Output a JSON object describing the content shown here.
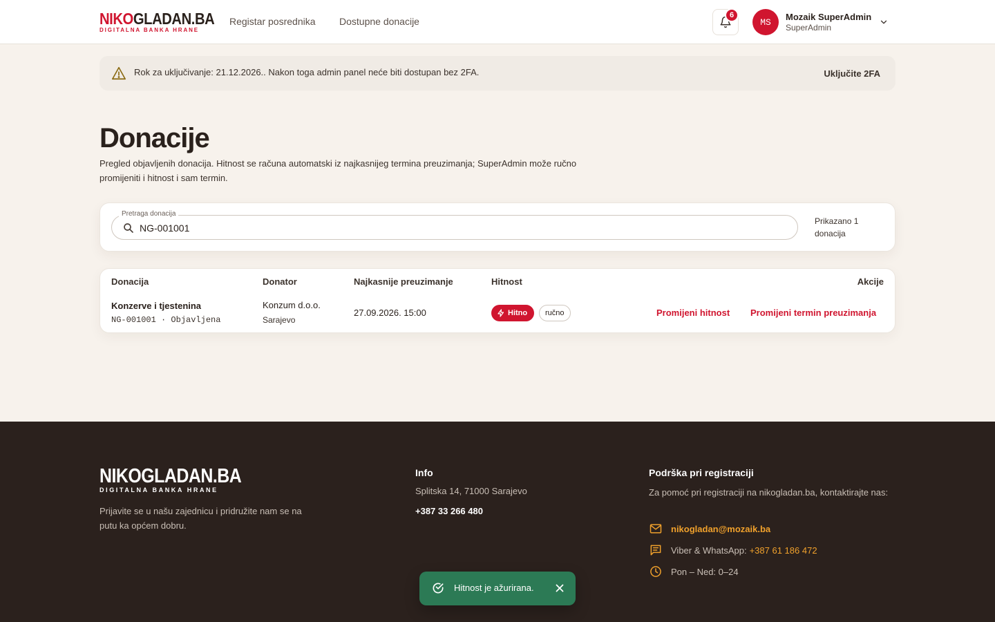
{
  "brand": {
    "wordmark_a": "NIKO",
    "wordmark_b": "GLADAN.BA",
    "tagline": "DIGITALNA BANKA HRANE"
  },
  "nav": {
    "items": [
      {
        "label": "Registar posrednika"
      },
      {
        "label": "Dostupne donacije"
      }
    ]
  },
  "notifications": {
    "count": "6",
    "icon": "bell-icon"
  },
  "user": {
    "initials": "MS",
    "name": "Mozaik SuperAdmin",
    "role": "SuperAdmin"
  },
  "banner": {
    "text": "Rok za uključivanje: 21.12.2026.. Nakon toga admin panel neće biti dostupan bez 2FA.",
    "action": "Uključite 2FA",
    "icon": "warning-icon"
  },
  "page": {
    "title": "Donacije",
    "description": "Pregled objavljenih donacija. Hitnost se računa automatski iz najkasnijeg termina preuzimanja; SuperAdmin može ručno promijeniti i hitnost i sam termin."
  },
  "search": {
    "legend": "Pretraga donacija",
    "value": "NG-001001",
    "count_text": "Prikazano 1 donacija"
  },
  "table": {
    "columns": [
      "Donacija",
      "Donator",
      "Najkasnije preuzimanje",
      "Hitnost",
      "Akcije"
    ],
    "rows": [
      {
        "title": "Konzerve i tjestenina",
        "code": "NG-001001 · Objavljena",
        "donor": "Konzum d.o.o.",
        "city": "Sarajevo",
        "deadline": "27.09.2026. 15:00",
        "urgency": "Hitno",
        "urgency_mode": "ručno",
        "action_urgency": "Promijeni hitnost",
        "action_deadline": "Promijeni termin preuzimanja"
      }
    ]
  },
  "footer": {
    "wordmark": "NIKOGLADAN.BA",
    "tagline": "DIGITALNA BANKA HRANE",
    "about": "Prijavite se u našu zajednicu i pridružite nam se na putu ka općem dobru.",
    "info_title": "Info",
    "address": "Splitska 14, 71000 Sarajevo",
    "phone": "+387 33 266 480",
    "support_title": "Podrška pri registraciji",
    "support_text": "Za pomoć pri registraciji na nikogladan.ba, kontaktirajte nas:",
    "email": "nikogladan@mozaik.ba",
    "viber_label": "Viber & WhatsApp:",
    "viber_number": "+387 61 186 472",
    "hours": "Pon – Ned: 0–24"
  },
  "toast": {
    "text": "Hitnost je ažurirana.",
    "color": "#2c7a55"
  },
  "colors": {
    "brand_red": "#d0152f",
    "footer_bg": "#2b211d",
    "accent_orange": "#f0a12c",
    "page_bg": "#f7f2ec"
  }
}
